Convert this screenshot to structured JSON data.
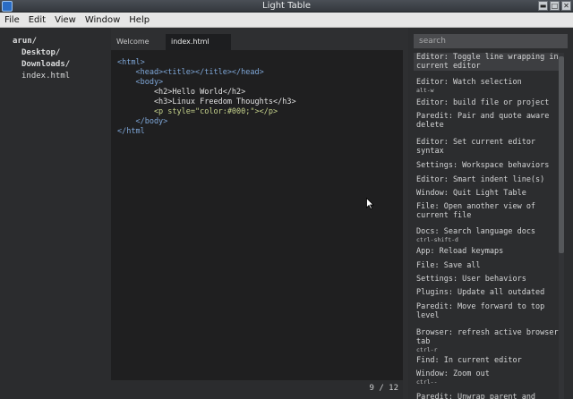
{
  "window": {
    "title": "Light Table"
  },
  "menu": [
    "File",
    "Edit",
    "View",
    "Window",
    "Help"
  ],
  "workspace": {
    "items": [
      {
        "label": "arun/",
        "type": "folder"
      },
      {
        "label": "Desktop/",
        "type": "folder"
      },
      {
        "label": "Downloads/",
        "type": "folder"
      },
      {
        "label": "index.html",
        "type": "file"
      }
    ]
  },
  "tabs": [
    {
      "label": "Welcome",
      "active": false
    },
    {
      "label": "index.html",
      "active": true
    }
  ],
  "editor": {
    "lines": [
      "<html>",
      "    <head><title></title></head>",
      "    <body>",
      "        <h2>Hello World</h2>",
      "        <h3>Linux Freedom Thoughts</h3>",
      "        <p style=\"color:#000;\"></p>",
      "    </body>",
      "</html"
    ],
    "status": "9 / 12"
  },
  "palette": {
    "placeholder": "search",
    "commands": [
      {
        "name": "Editor: Toggle line wrapping in current editor",
        "key": "",
        "selected": true
      },
      {
        "name": "Editor: Watch selection",
        "key": "alt-w"
      },
      {
        "name": "Editor: build file or project",
        "key": ""
      },
      {
        "name": "Paredit: Pair and quote aware delete",
        "key": ""
      },
      {
        "name": "Editor: Set current editor syntax",
        "key": ""
      },
      {
        "name": "Settings: Workspace behaviors",
        "key": ""
      },
      {
        "name": "Editor: Smart indent line(s)",
        "key": ""
      },
      {
        "name": "Window: Quit Light Table",
        "key": ""
      },
      {
        "name": "File: Open another view of current file",
        "key": ""
      },
      {
        "name": "Docs: Search language docs",
        "key": "ctrl-shift-d"
      },
      {
        "name": "App: Reload keymaps",
        "key": ""
      },
      {
        "name": "File: Save all",
        "key": ""
      },
      {
        "name": "Settings: User behaviors",
        "key": ""
      },
      {
        "name": "Plugins: Update all outdated",
        "key": ""
      },
      {
        "name": "Paredit: Move forward to top level",
        "key": ""
      },
      {
        "name": "Browser: refresh active browser tab",
        "key": "ctrl-r"
      },
      {
        "name": "Find: In current editor",
        "key": ""
      },
      {
        "name": "Window: Zoom out",
        "key": "ctrl--"
      },
      {
        "name": "Paredit: Unwrap parent and",
        "key": ""
      }
    ]
  }
}
